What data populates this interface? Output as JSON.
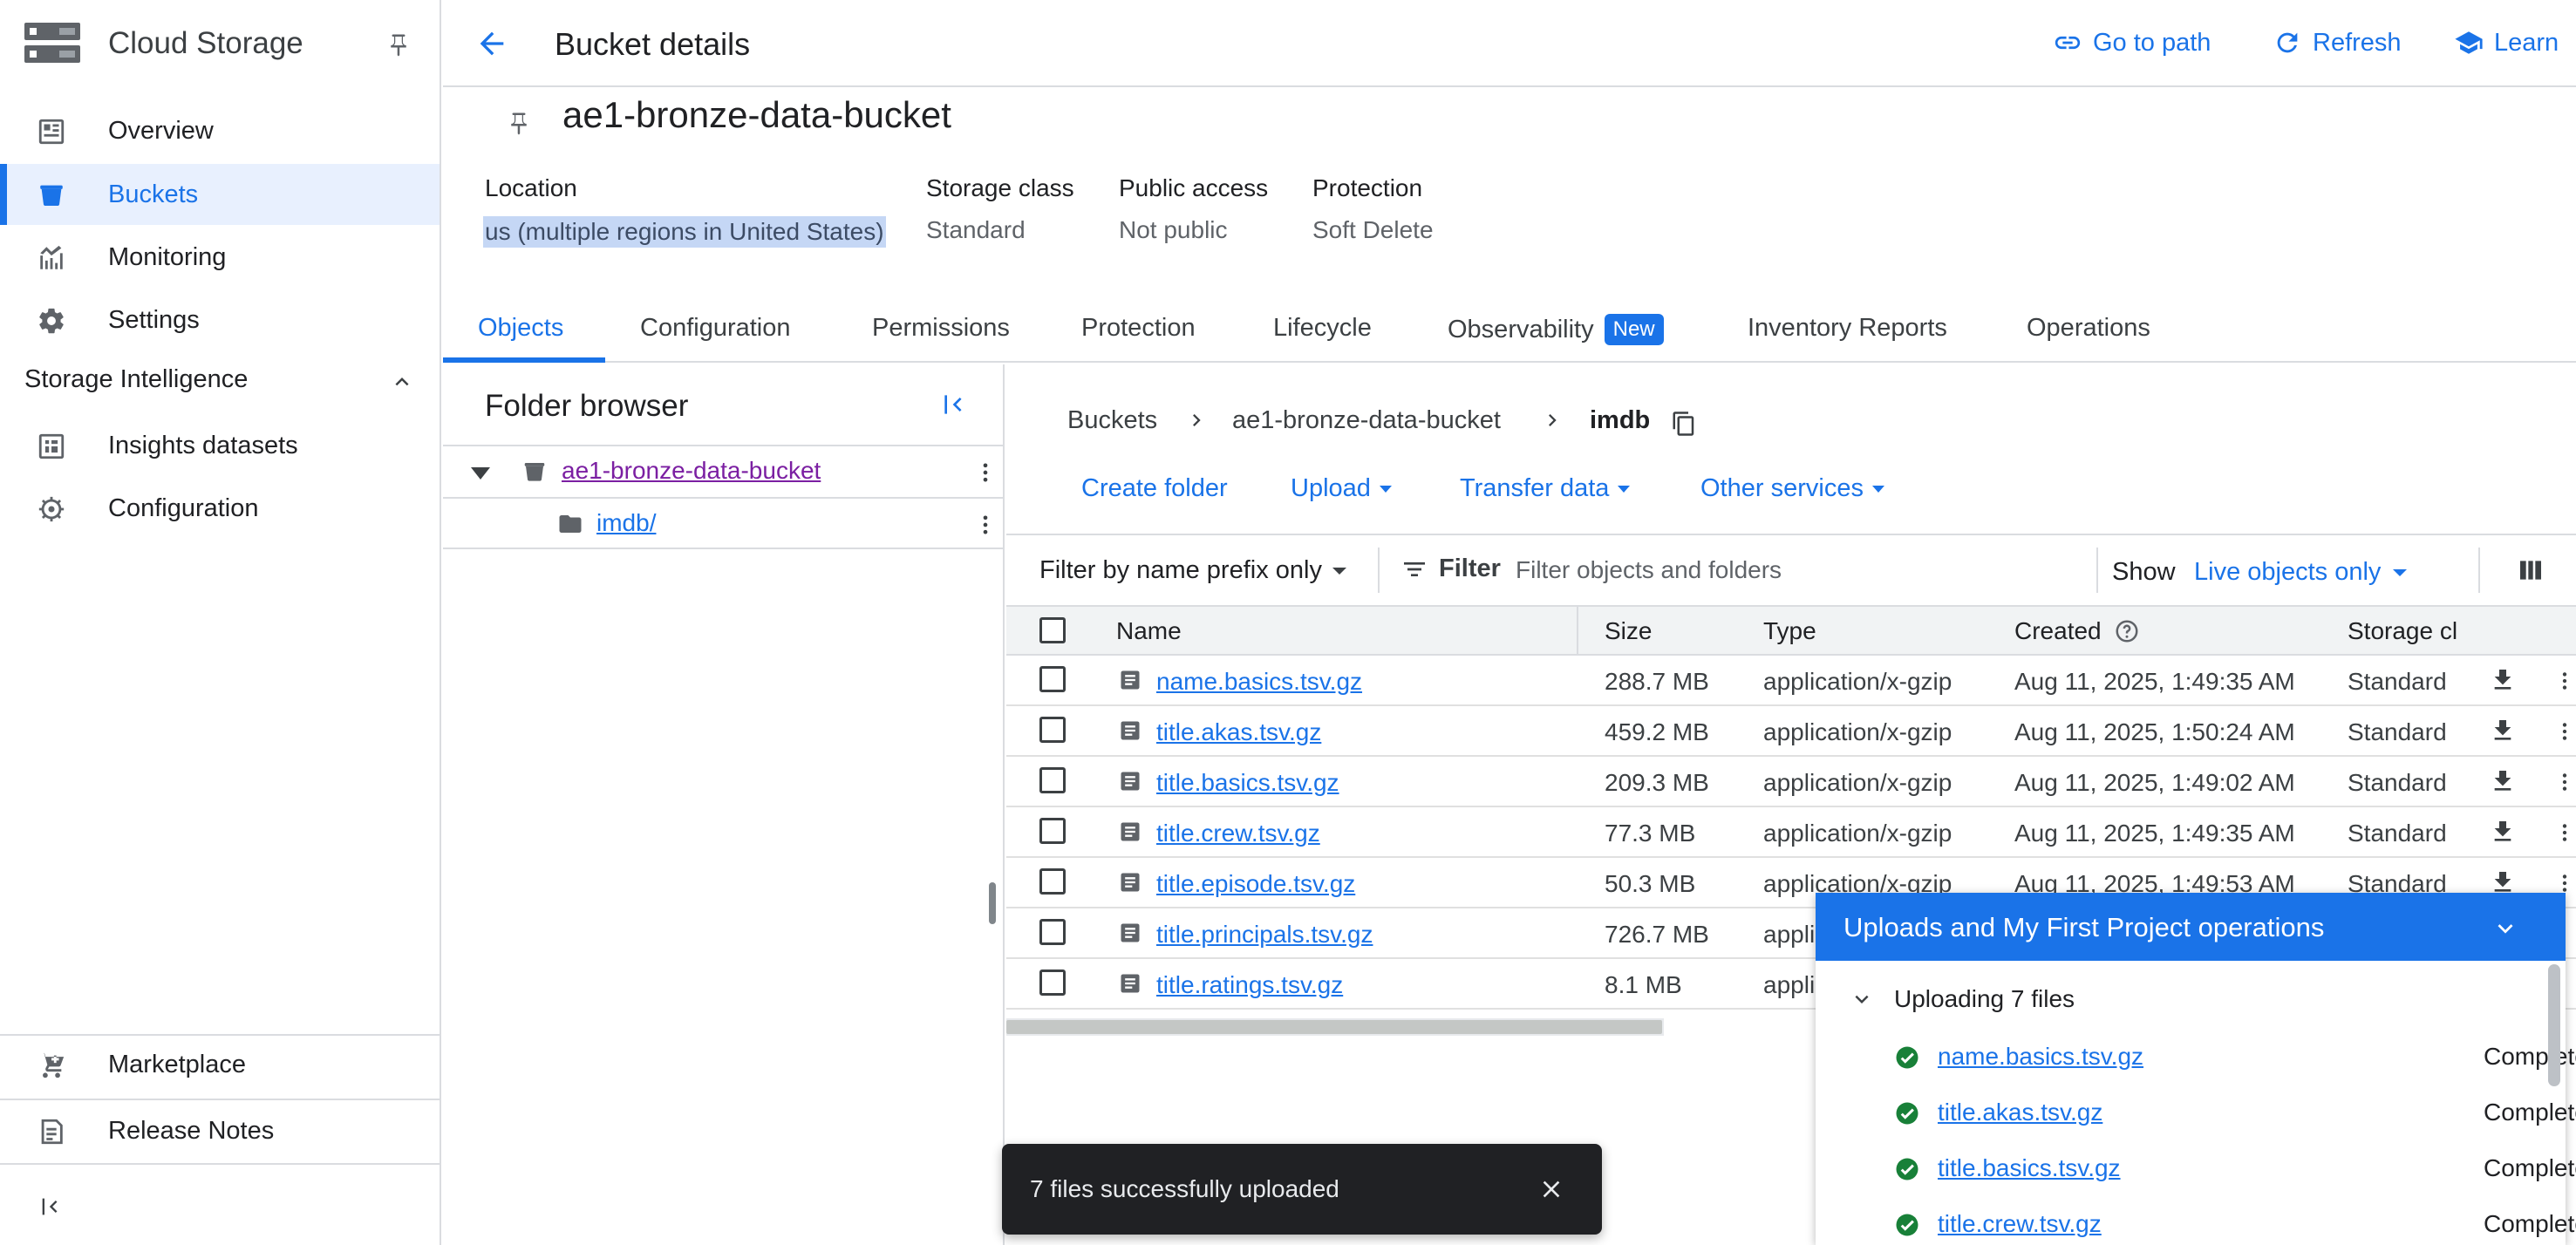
{
  "sidebar": {
    "product_title": "Cloud Storage",
    "items": [
      {
        "label": "Overview",
        "icon": "dashboard-icon"
      },
      {
        "label": "Buckets",
        "icon": "bucket-icon",
        "active": true
      },
      {
        "label": "Monitoring",
        "icon": "monitoring-icon"
      },
      {
        "label": "Settings",
        "icon": "gear-icon"
      }
    ],
    "section_title": "Storage Intelligence",
    "section_items": [
      {
        "label": "Insights datasets",
        "icon": "dataset-icon"
      },
      {
        "label": "Configuration",
        "icon": "config-gear-icon"
      }
    ],
    "bottom_items": [
      {
        "label": "Marketplace",
        "icon": "cart-icon"
      },
      {
        "label": "Release Notes",
        "icon": "release-notes-icon"
      }
    ]
  },
  "header": {
    "title": "Bucket details",
    "actions": {
      "go_to_path": "Go to path",
      "refresh": "Refresh",
      "learn": "Learn"
    }
  },
  "bucket": {
    "name": "ae1-bronze-data-bucket",
    "location_label": "Location",
    "location_value": "us (multiple regions in United States)",
    "storage_class_label": "Storage class",
    "storage_class_value": "Standard",
    "public_access_label": "Public access",
    "public_access_value": "Not public",
    "protection_label": "Protection",
    "protection_value": "Soft Delete"
  },
  "tabs": {
    "objects": "Objects",
    "configuration": "Configuration",
    "permissions": "Permissions",
    "protection": "Protection",
    "lifecycle": "Lifecycle",
    "observability": "Observability",
    "observability_badge": "New",
    "inventory_reports": "Inventory Reports",
    "operations": "Operations"
  },
  "folder_browser": {
    "title": "Folder browser",
    "bucket": "ae1-bronze-data-bucket",
    "folder": "imdb/"
  },
  "breadcrumb": {
    "root": "Buckets",
    "bucket": "ae1-bronze-data-bucket",
    "folder": "imdb"
  },
  "actions": {
    "create_folder": "Create folder",
    "upload": "Upload",
    "transfer_data": "Transfer data",
    "other_services": "Other services"
  },
  "filter": {
    "prefix_mode": "Filter by name prefix only",
    "filter_label": "Filter",
    "placeholder": "Filter objects and folders",
    "show_label": "Show",
    "show_value": "Live objects only"
  },
  "table": {
    "columns": {
      "name": "Name",
      "size": "Size",
      "type": "Type",
      "created": "Created",
      "storage_class": "Storage cl"
    },
    "rows": [
      {
        "name": "name.basics.tsv.gz",
        "size": "288.7 MB",
        "type": "application/x-gzip",
        "created": "Aug 11, 2025, 1:49:35 AM",
        "storage": "Standard"
      },
      {
        "name": "title.akas.tsv.gz",
        "size": "459.2 MB",
        "type": "application/x-gzip",
        "created": "Aug 11, 2025, 1:50:24 AM",
        "storage": "Standard"
      },
      {
        "name": "title.basics.tsv.gz",
        "size": "209.3 MB",
        "type": "application/x-gzip",
        "created": "Aug 11, 2025, 1:49:02 AM",
        "storage": "Standard"
      },
      {
        "name": "title.crew.tsv.gz",
        "size": "77.3 MB",
        "type": "application/x-gzip",
        "created": "Aug 11, 2025, 1:49:35 AM",
        "storage": "Standard"
      },
      {
        "name": "title.episode.tsv.gz",
        "size": "50.3 MB",
        "type": "application/x-gzip",
        "created": "Aug 11, 2025, 1:49:53 AM",
        "storage": "Standard"
      },
      {
        "name": "title.principals.tsv.gz",
        "size": "726.7 MB",
        "type": "appli",
        "created": "",
        "storage": ""
      },
      {
        "name": "title.ratings.tsv.gz",
        "size": "8.1 MB",
        "type": "appli",
        "created": "",
        "storage": ""
      }
    ]
  },
  "toast": {
    "message": "7 files successfully uploaded"
  },
  "uploads_panel": {
    "title": "Uploads and My First Project operations",
    "group_label": "Uploading 7 files",
    "items": [
      {
        "name": "name.basics.tsv.gz",
        "status": "Complete"
      },
      {
        "name": "title.akas.tsv.gz",
        "status": "Complete"
      },
      {
        "name": "title.basics.tsv.gz",
        "status": "Complete"
      },
      {
        "name": "title.crew.tsv.gz",
        "status": "Complete"
      }
    ]
  },
  "colors": {
    "accent": "#1a73e8",
    "success": "#188038",
    "visited_link": "#7b1fa2",
    "selection": "#c5d7f5"
  }
}
